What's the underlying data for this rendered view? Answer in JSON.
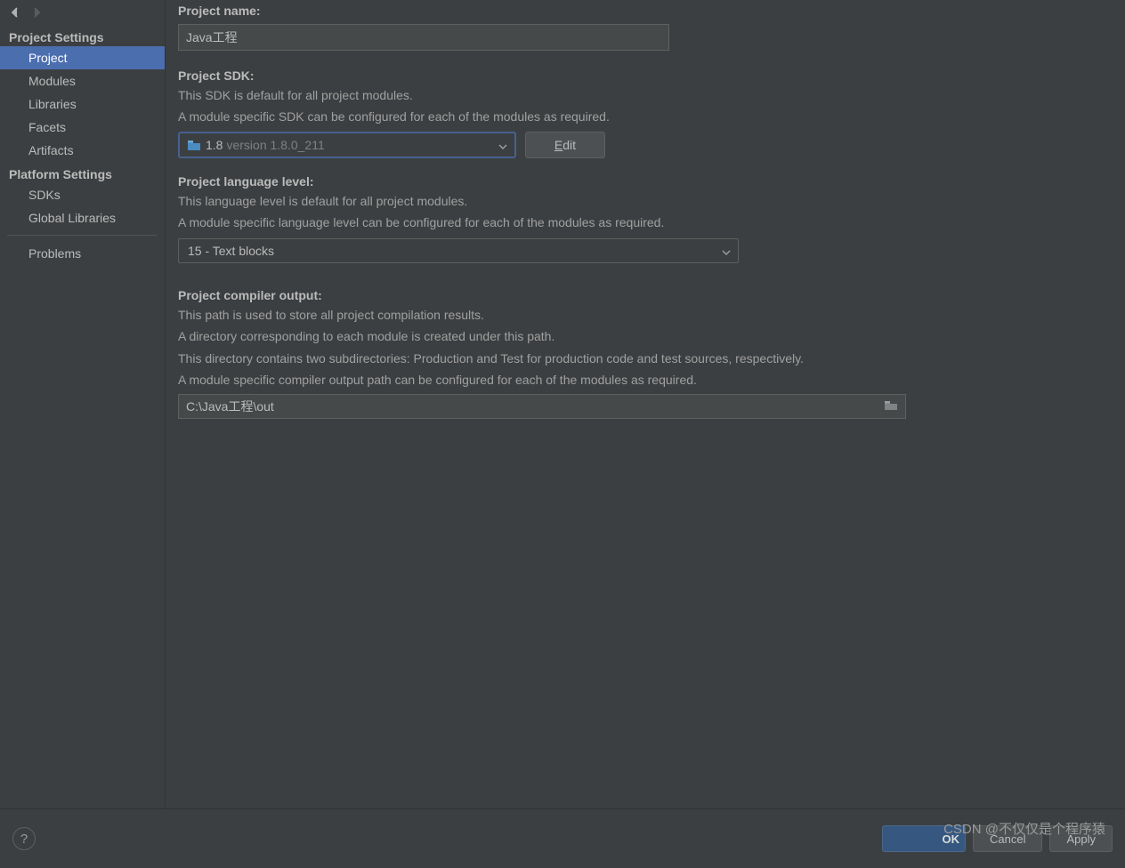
{
  "sidebar": {
    "sections": {
      "project_settings": {
        "header": "Project Settings",
        "items": [
          "Project",
          "Modules",
          "Libraries",
          "Facets",
          "Artifacts"
        ],
        "selected": "Project"
      },
      "platform_settings": {
        "header": "Platform Settings",
        "items": [
          "SDKs",
          "Global Libraries"
        ]
      },
      "standalone": "Problems"
    }
  },
  "main": {
    "project_name": {
      "label": "Project name:",
      "value": "Java工程"
    },
    "project_sdk": {
      "label": "Project SDK:",
      "desc1": "This SDK is default for all project modules.",
      "desc2": "A module specific SDK can be configured for each of the modules as required.",
      "selected_main": "1.8",
      "selected_detail": "version 1.8.0_211",
      "edit_prefix": "E",
      "edit_rest": "dit"
    },
    "project_language_level": {
      "label": "Project language level:",
      "desc1": "This language level is default for all project modules.",
      "desc2": "A module specific language level can be configured for each of the modules as required.",
      "selected": "15 - Text blocks"
    },
    "project_output": {
      "label": "Project compiler output:",
      "desc1": "This path is used to store all project compilation results.",
      "desc2": "A directory corresponding to each module is created under this path.",
      "desc3": "This directory contains two subdirectories: Production and Test for production code and test sources, respectively.",
      "desc4": "A module specific compiler output path can be configured for each of the modules as required.",
      "value": "C:\\Java工程\\out"
    }
  },
  "footer": {
    "ok": "OK",
    "cancel": "Cancel",
    "apply": "Apply"
  },
  "watermark": "CSDN @不仅仅是个程序猿"
}
